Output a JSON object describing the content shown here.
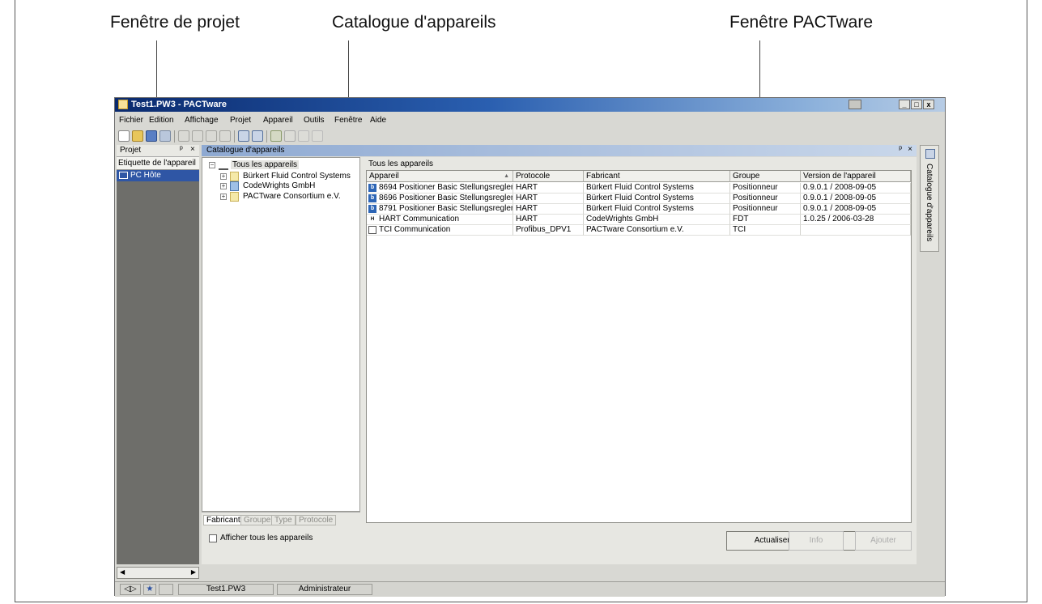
{
  "callouts": {
    "project": "Fenêtre de projet",
    "catalog": "Catalogue d'appareils",
    "pactware": "Fenêtre PACTware"
  },
  "window": {
    "title": "Test1.PW3 - PACTware",
    "controls": [
      "_",
      "□",
      "x"
    ]
  },
  "menu": [
    "Fichier",
    "Edition",
    "Affichage",
    "Projet",
    "Appareil",
    "Outils",
    "Fenêtre",
    "Aide"
  ],
  "project_pane": {
    "title": "Projet",
    "column": "Etiquette de l'appareil",
    "item": "PC Hôte"
  },
  "catalog_pane": {
    "title": "Catalogue d'appareils",
    "tree": {
      "root": "Tous les appareils",
      "children": [
        "Bürkert Fluid Control Systems",
        "CodeWrights GmbH",
        "PACTware Consortium e.V."
      ]
    },
    "tabs": [
      "Fabricant",
      "Groupe",
      "Type",
      "Protocole"
    ],
    "show_all_label": "Afficher tous les appareils",
    "list_caption": "Tous les appareils",
    "columns": [
      "Appareil",
      "Protocole",
      "Fabricant",
      "Groupe",
      "Version de l'appareil"
    ],
    "rows": [
      [
        "8694 Positioner Basic Stellungsregler",
        "HART",
        "Bürkert Fluid Control Systems",
        "Positionneur",
        "0.9.0.1 / 2008-09-05"
      ],
      [
        "8696 Positioner Basic Stellungsregler",
        "HART",
        "Bürkert Fluid Control Systems",
        "Positionneur",
        "0.9.0.1 / 2008-09-05"
      ],
      [
        "8791 Positioner Basic Stellungsregler",
        "HART",
        "Bürkert Fluid Control Systems",
        "Positionneur",
        "0.9.0.1 / 2008-09-05"
      ],
      [
        "HART Communication",
        "HART",
        "CodeWrights GmbH",
        "FDT",
        "1.0.25 / 2006-03-28"
      ],
      [
        "TCI Communication",
        "Profibus_DPV1",
        "PACTware Consortium e.V.",
        "TCI",
        ""
      ]
    ],
    "buttons": {
      "refresh": "Actualiser le catalogue",
      "info": "Info",
      "add": "Ajouter"
    }
  },
  "side_tab": "Catalogue d'appareils",
  "status": {
    "file": "Test1.PW3",
    "user": "Administrateur"
  }
}
